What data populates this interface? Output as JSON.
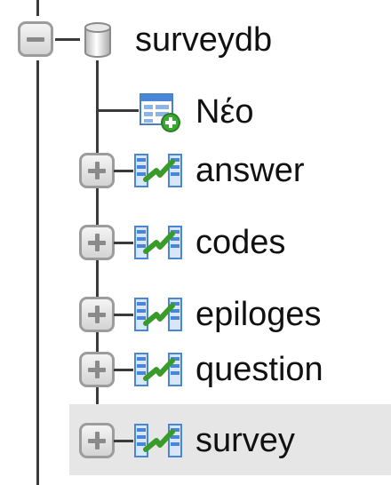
{
  "tree": {
    "database": {
      "label": "surveydb",
      "toggle": "collapse",
      "icon": "database-icon"
    },
    "new_item": {
      "label": "Νέο",
      "icon": "new-table-icon"
    },
    "tables": [
      {
        "label": "answer",
        "icon": "table-structure-icon",
        "toggle": "expand"
      },
      {
        "label": "codes",
        "icon": "table-structure-icon",
        "toggle": "expand"
      },
      {
        "label": "epiloges",
        "icon": "table-structure-icon",
        "toggle": "expand"
      },
      {
        "label": "question",
        "icon": "table-structure-icon",
        "toggle": "expand"
      },
      {
        "label": "survey",
        "icon": "table-structure-icon",
        "toggle": "expand",
        "highlighted": true
      }
    ]
  },
  "colors": {
    "line": "#3a3a3a",
    "toggle_border": "#9c9c9c",
    "highlight": "#e6e6e6",
    "table_icon_blue": "#4a86d6",
    "check_green": "#3a9a2a"
  }
}
